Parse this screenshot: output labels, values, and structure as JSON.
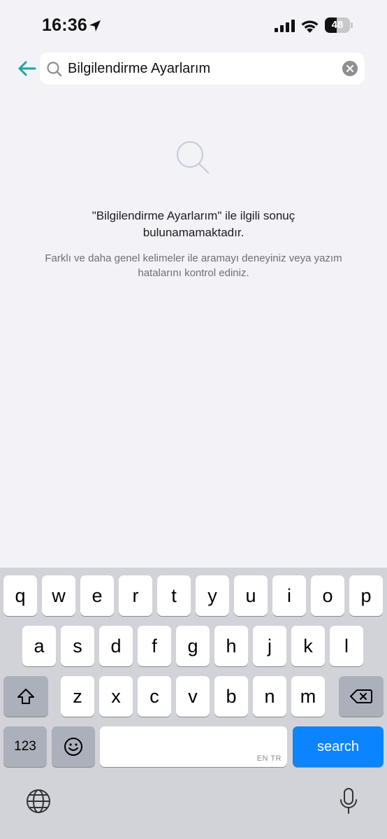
{
  "status_bar": {
    "time": "16:36",
    "battery_text": "48",
    "battery_level": 0.48,
    "icons": [
      "location-arrow-icon",
      "signal-icon",
      "wifi-icon",
      "battery-icon"
    ]
  },
  "search": {
    "query": "Bilgilendirme Ayarlarım",
    "icons": [
      "back-arrow-icon",
      "search-icon",
      "clear-icon"
    ]
  },
  "empty_state": {
    "title": "\"Bilgilendirme Ayarlarım\" ile ilgili sonuç bulunamamaktadır.",
    "description": "Farklı ve daha genel kelimeler ile aramayı deneyiniz veya yazım hatalarını kontrol ediniz.",
    "icon": "search-icon"
  },
  "keyboard": {
    "row1": [
      "q",
      "w",
      "e",
      "r",
      "t",
      "y",
      "u",
      "i",
      "o",
      "p"
    ],
    "row2": [
      "a",
      "s",
      "d",
      "f",
      "g",
      "h",
      "j",
      "k",
      "l"
    ],
    "row3": [
      "z",
      "x",
      "c",
      "v",
      "b",
      "n",
      "m"
    ],
    "numbers_label": "123",
    "space_hint": "EN TR",
    "search_label": "search",
    "icons": [
      "shift-icon",
      "delete-icon",
      "emoji-icon",
      "globe-icon",
      "microphone-icon"
    ]
  },
  "colors": {
    "accent": "#1aa7a7",
    "background": "#f2f2f7",
    "search_key": "#0a84ff",
    "keyboard_bg": "#d1d3d9"
  }
}
